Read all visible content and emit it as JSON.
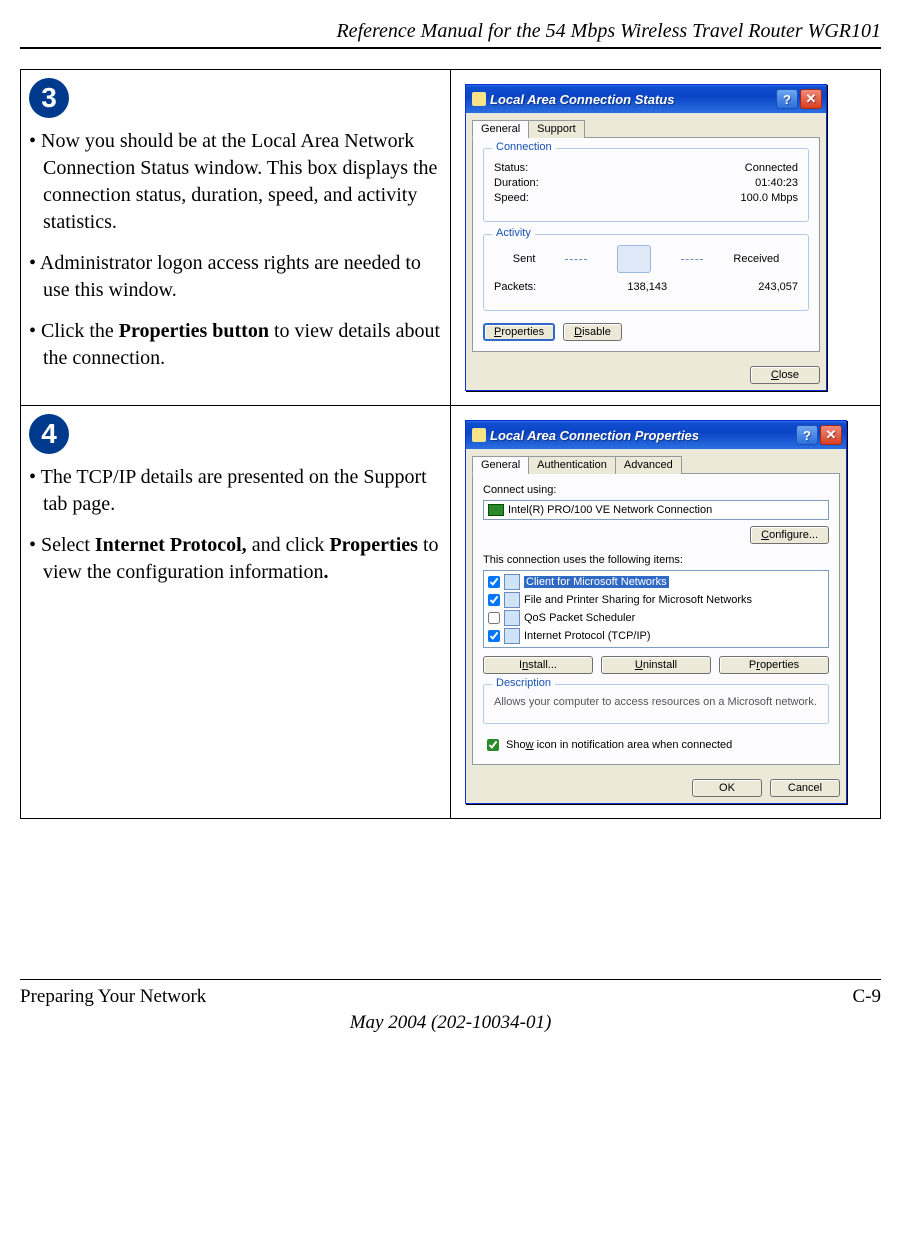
{
  "header": {
    "title": "Reference Manual for the 54 Mbps Wireless Travel Router WGR101"
  },
  "steps": {
    "s3": {
      "num": "3",
      "b1": "• Now you should be at the Local Area Network Connection Status window. This box displays the connection status, duration, speed, and activity statistics.",
      "b2": "• Administrator logon access rights are needed to use this window.",
      "b3_pre": "• Click the ",
      "b3_bold": "Properties button",
      "b3_post": " to view details about the connection."
    },
    "s4": {
      "num": "4",
      "b1": "• The TCP/IP details are presented on the Support tab page.",
      "b2_pre": "• Select ",
      "b2_bold1": "Internet Protocol,",
      "b2_mid": " and click ",
      "b2_bold2": "Properties",
      "b2_post": " to view the configuration information",
      "b2_dot": "."
    }
  },
  "win1": {
    "title": "Local Area Connection Status",
    "tabs": {
      "general": "General",
      "support": "Support"
    },
    "conn_legend": "Connection",
    "status_l": "Status:",
    "status_v": "Connected",
    "dur_l": "Duration:",
    "dur_v": "01:40:23",
    "speed_l": "Speed:",
    "speed_v": "100.0 Mbps",
    "act_legend": "Activity",
    "sent": "Sent",
    "recv": "Received",
    "packets_l": "Packets:",
    "sent_v": "138,143",
    "recv_v": "243,057",
    "btn_props": "Properties",
    "btn_disable": "Disable",
    "btn_close": "Close"
  },
  "win2": {
    "title": "Local Area Connection Properties",
    "tabs": {
      "general": "General",
      "auth": "Authentication",
      "adv": "Advanced"
    },
    "connect_using": "Connect using:",
    "adapter": "Intel(R) PRO/100 VE Network Connection",
    "btn_configure": "Configure...",
    "uses_label": "This connection uses the following items:",
    "items": {
      "i1": "Client for Microsoft Networks",
      "i2": "File and Printer Sharing for Microsoft Networks",
      "i3": "QoS Packet Scheduler",
      "i4": "Internet Protocol (TCP/IP)"
    },
    "btn_install": "Install...",
    "btn_uninstall": "Uninstall",
    "btn_props": "Properties",
    "desc_legend": "Description",
    "desc_text": "Allows your computer to access resources on a Microsoft network.",
    "show_icon": "Show icon in notification area when connected",
    "btn_ok": "OK",
    "btn_cancel": "Cancel"
  },
  "footer": {
    "left": "Preparing Your Network",
    "right": "C-9",
    "date": "May 2004 (202-10034-01)"
  }
}
